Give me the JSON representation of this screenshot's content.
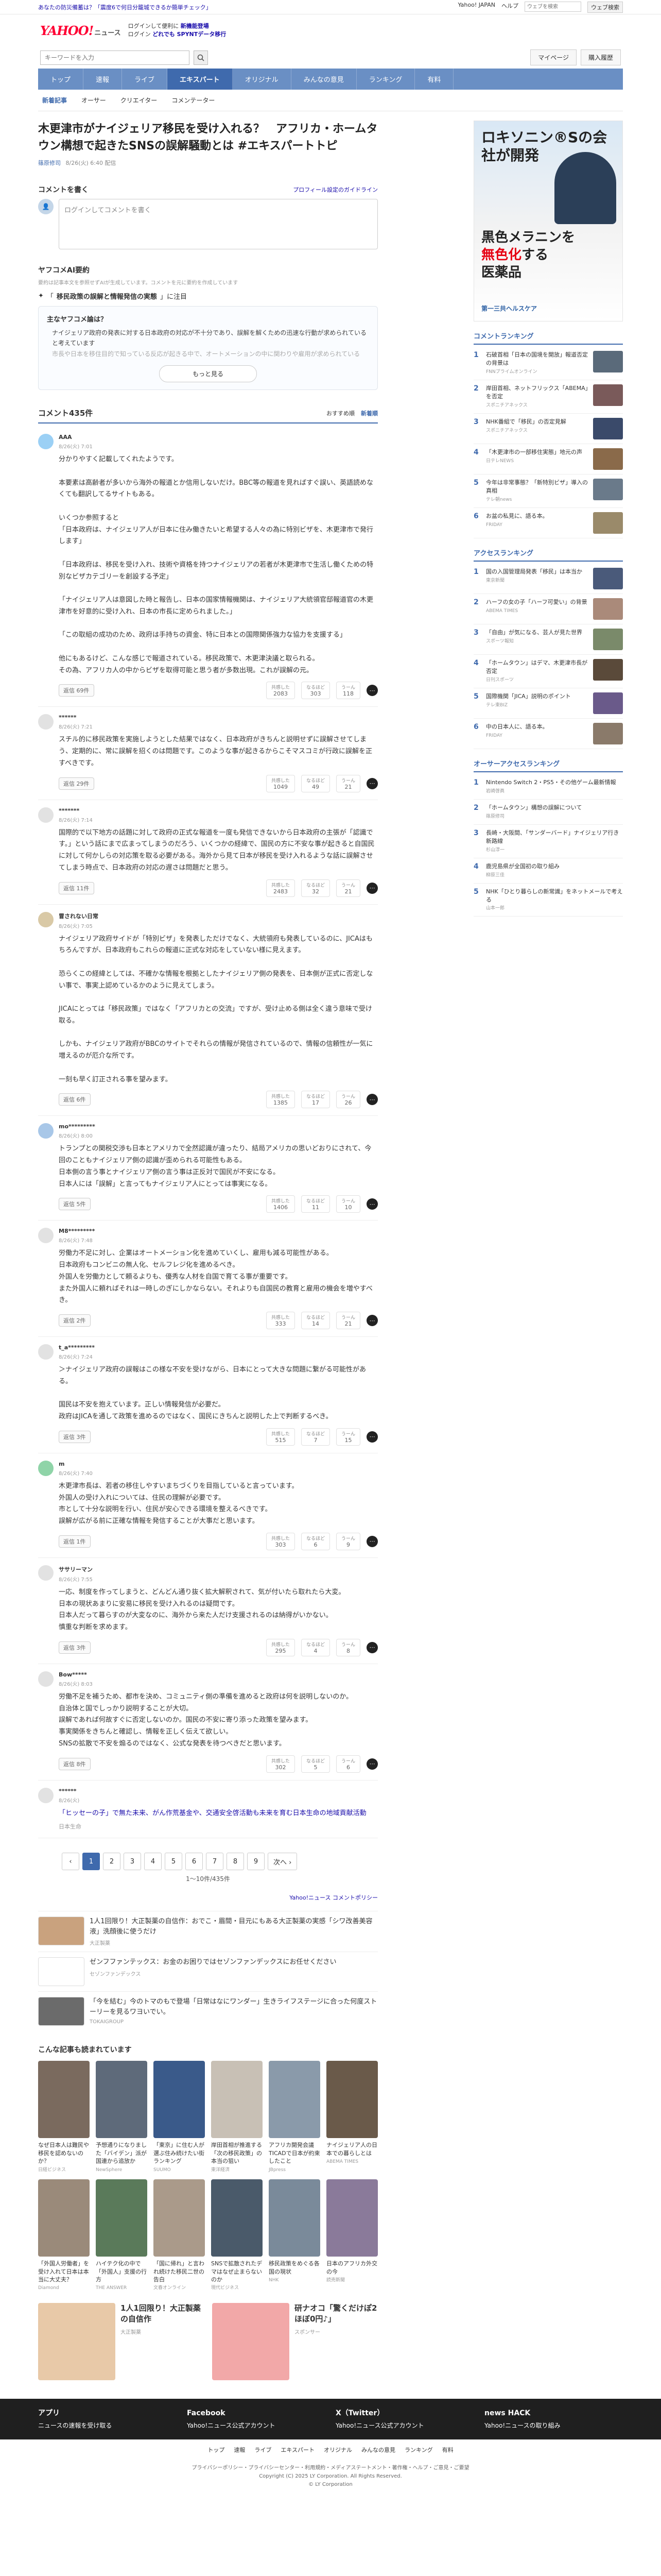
{
  "topbar": {
    "notice": "あなたの防災備蓄は？「震度6で何日分籠城できるか簡単チェック」",
    "links": [
      "Yahoo! JAPAN",
      "ヘルプ"
    ],
    "search_placeholder": "ウェブを検索",
    "search_button": "ウェブ検索"
  },
  "header": {
    "logo": "YAHOO!",
    "logo_sub": "ニュース",
    "info_line1": "ログインして便利に",
    "info_line1_b": "新機能登場",
    "info_line2": "ログイン",
    "info_line2_b": "どれでも SPYNTデータ移行",
    "search_button": "検索"
  },
  "searchbar": {
    "placeholder": "キーワードを入力",
    "right_buttons": [
      "マイページ",
      "購入履歴"
    ]
  },
  "nav": {
    "items": [
      "トップ",
      "速報",
      "ライブ",
      "エキスパート",
      "オリジナル",
      "みんなの意見",
      "ランキング",
      "有料"
    ],
    "active": "エキスパート"
  },
  "subnav": {
    "items": [
      "新着記事",
      "オーサー",
      "クリエイター",
      "コメンテーター"
    ]
  },
  "article": {
    "title": "木更津市がナイジェリア移民を受け入れる？　アフリカ・ホームタウン構想で起きたSNSの誤解騒動とは #エキスパートトピ",
    "author": "篠原修司",
    "date": "8/26(火) 6:40 配信"
  },
  "comment_form": {
    "heading": "コメントを書く",
    "policy_link": "プロフィール設定のガイドライン",
    "placeholder": "ログインしてコメントを書く"
  },
  "ai_summary": {
    "heading": "ヤフコメAI要約",
    "note": "要約は記事本文を参照せずAIが生成しています。コメントを元に要約を作成しています",
    "topic_prefix": "「",
    "topic": "移民政策の誤解と情報発信の実態",
    "topic_suffix": "」に注目",
    "card_title": "主なヤフコメ論は？",
    "points": [
      "ナイジェリア政府の発表に対する日本政府の対応が不十分であり、誤解を解くための迅速な行動が求められていると考えています",
      "市長や日本を移住目的で知っている反応が起きる中で、オートメーションの中に関わりや雇用が求められている"
    ],
    "more_button": "もっと見る"
  },
  "comments_meta": {
    "count_label": "コメント435件",
    "sort": [
      "おすすめ順",
      "新着順"
    ]
  },
  "comments": [
    {
      "name": "AAA",
      "date": "8/26(火) 7:01",
      "text": "分かりやすく記載してくれたようです。\n\n本要素は高齢者が多いから海外の報道とか信用しないだけ。BBC等の報道を見ればすぐ誤い、英語読めなくても翻訳してるサイトもある。\n\nいくつか参照すると\n「日本政府は、ナイジェリア人が日本に住み働きたいと希望する人々の為に特別ビザを、木更津市で発行します」\n\n「日本政府は、移民を受け入れ、技術や資格を持つナイジェリアの若者が木更津市で生活し働くための特別なビザカテゴリーを創設する予定」\n\n「ナイジェリア人は意図した時と報告し、日本の国家情報機関は、ナイジェリア大統領官邸報道官の木更津市を好意的に受け入れ、日本の市長に定められました。」\n\n「この取組の成功のため、政府は手持ちの資金、特に日本との国際関係強力な協力を支援する」\n\n他にもあるけど、こんな感じで報道されている。移民政策で、木更津決議と取られる。\nその為、アフリカ人の中からビザを取得可能と思う者が多数出現。これが誤解の元。",
      "reply": "返信 69件",
      "react": [
        [
          "共感した",
          "2083"
        ],
        [
          "なるほど",
          "303"
        ],
        [
          "うーん",
          "118"
        ]
      ],
      "avatar": "#9bd0f5"
    },
    {
      "name": "******",
      "date": "8/26(火) 7:21",
      "text": "スチル的に移民政策を実施しようとした結果ではなく、日本政府がきちんと説明せずに誤解させてしまう、定期的に、常に誤解を招くのは問題です。このような事が起きるからこそマスコミが行政に誤解を正すべきです。",
      "reply": "返信 29件",
      "react": [
        [
          "共感した",
          "1049"
        ],
        [
          "なるほど",
          "49"
        ],
        [
          "うーん",
          "21"
        ]
      ],
      "avatar": "#e2e2e2"
    },
    {
      "name": "*******",
      "date": "8/26(火) 7:14",
      "text": "国際的で以下地方の話題に対して政府の正式な報道を一度も発信できないから日本政府の主張が「認識です。」という話にまで広まってしまうのだろう、いくつかの経緯で、国民の方に不安な事が起きると自国民に対して何かしらの対応策を取る必要がある。海外から見て日本が移民を受け入れるような話に誤解させてしまう時点で、日本政府の対応の遅さは問題だと思う。",
      "reply": "返信 11件",
      "react": [
        [
          "共感した",
          "2483"
        ],
        [
          "なるほど",
          "32"
        ],
        [
          "うーん",
          "21"
        ]
      ],
      "avatar": "#e2e2e2"
    },
    {
      "name": "冒されない日常",
      "date": "8/26(火) 7:05",
      "text": "ナイジェリア政府サイドが「特別ビザ」を発表しただけでなく、大統領府も発表しているのに、JICAはもちろんですが、日本政府もこれらの報道に正式な対応をしていない様に見えます。\n\n恐らくこの経緯としては、不確かな情報を根拠としたナイジェリア側の発表を、日本側が正式に否定しない事で、事実上認めているかのように見えてしまう。\n\nJICAにとっては「移民政策」ではなく「アフリカとの交流」ですが、受け止める側は全く違う意味で受け取る。\n\nしかも、ナイジェリア政府がBBCのサイトでそれらの情報が発信されているので、情報の信頼性が一気に増えるのが厄介な所です。\n\n一刻も早く訂正される事を望みます。",
      "reply": "返信 6件",
      "react": [
        [
          "共感した",
          "1385"
        ],
        [
          "なるほど",
          "17"
        ],
        [
          "うーん",
          "26"
        ]
      ],
      "avatar": "#d9c9a6"
    },
    {
      "name": "mo*********",
      "date": "8/26(火) 8:00",
      "text": "トランプとの関税交渉も日本とアメリカで全然認識が違ったり、結局アメリカの思いどおりにされて、今回のこともナイジェリア側の認識が歪められる可能性もある。\n日本側の言う事とナイジェリア側の言う事は正反対で国民が不安になる。\n日本人には「誤解」と言ってもナイジェリア人にとっては事実になる。",
      "reply": "返信 5件",
      "react": [
        [
          "共感した",
          "1406"
        ],
        [
          "なるほど",
          "11"
        ],
        [
          "うーん",
          "10"
        ]
      ],
      "avatar": "#a8c7e8"
    },
    {
      "name": "M8*********",
      "date": "8/26(火) 7:48",
      "text": "労働力不足に対し、企業はオートメーション化を進めていくし、雇用も減る可能性がある。\n日本政府もコンビニの無人化、セルフレジ化を進めるべき。\n外国人を労働力として頼るよりも、優秀な人材を自国で育てる事が重要です。\nまた外国人に頼ればそれは一時しのぎにしかならない。それよりも自国民の教育と雇用の機会を増やすべき。",
      "reply": "返信 2件",
      "react": [
        [
          "共感した",
          "333"
        ],
        [
          "なるほど",
          "14"
        ],
        [
          "うーん",
          "21"
        ]
      ],
      "avatar": "#e2e2e2"
    },
    {
      "name": "t_a*********",
      "date": "8/26(火) 7:24",
      "text": "＞ナイジェリア政府の誤報はこの様な不安を受けながら、日本にとって大きな問題に繋がる可能性がある。\n\n国民は不安を抱えています。正しい情報発信が必要だ。\n政府はJICAを通して政策を進めるのではなく、国民にきちんと説明した上で判断するべき。",
      "reply": "返信 3件",
      "react": [
        [
          "共感した",
          "515"
        ],
        [
          "なるほど",
          "7"
        ],
        [
          "うーん",
          "15"
        ]
      ],
      "avatar": "#e2e2e2"
    },
    {
      "name": "m",
      "date": "8/26(火) 7:40",
      "text": "木更津市長は、若者の移住しやすいまちづくりを目指していると言っています。\n外国人の受け入れについては、住民の理解が必要です。\n市として十分な説明を行い、住民が安心できる環境を整えるべきです。\n誤解が広がる前に正確な情報を発信することが大事だと思います。",
      "reply": "返信 1件",
      "react": [
        [
          "共感した",
          "303"
        ],
        [
          "なるほど",
          "6"
        ],
        [
          "うーん",
          "9"
        ]
      ],
      "avatar": "#8fd4a8"
    },
    {
      "name": "ササリーマン",
      "date": "8/26(火) 7:55",
      "text": "一応、制度を作ってしまうと、どんどん通り抜く拡大解釈されて、気が付いたら取れたら大変。\n日本の現状あまりに安易に移民を受け入れるのは疑問です。\n日本人だって暮らすのが大変なのに、海外から来た人だけ支援されるのは納得がいかない。\n慎重な判断を求めます。",
      "reply": "返信 3件",
      "react": [
        [
          "共感した",
          "295"
        ],
        [
          "なるほど",
          "4"
        ],
        [
          "うーん",
          "8"
        ]
      ],
      "avatar": "#e2e2e2"
    },
    {
      "name": "Bow*****",
      "date": "8/26(火) 8:03",
      "text": "労働不足を補うため、都市を決め、コミュニティ側の準備を進めると政府は何を説明しないのか。\n自治体と国でしっかり説明することが大切。\n誤解であれば何故すぐに否定しないのか。国民の不安に寄り添った政策を望みます。\n事実関係をきちんと確認し、情報を正しく伝えて欲しい。\nSNSの拡散で不安を煽るのではなく、公式な発表を待つべきだと思います。",
      "reply": "返信 8件",
      "react": [
        [
          "共感した",
          "302"
        ],
        [
          "なるほど",
          "5"
        ],
        [
          "うーん",
          "6"
        ]
      ],
      "avatar": "#e2e2e2"
    }
  ],
  "ps_comment": {
    "name": "******",
    "date": "8/26(火)",
    "text": "「ヒッセーの子」で無た未来、がん作荒基金や、交通安全啓活動も未来を育む日本生命の地域貢献活動",
    "sponsor": "日本生命"
  },
  "pager": {
    "pages": [
      "1",
      "2",
      "3",
      "4",
      "5",
      "6",
      "7",
      "8",
      "9"
    ],
    "prev": "‹",
    "next": "次へ ›",
    "active": "1",
    "count": "1〜10件/435件"
  },
  "policy_link": "Yahoo!ニュース コメントポリシー",
  "ads_list": [
    {
      "title": "1人1回限り！大正製薬の自信作：おでこ・眉間・目元にもある大正製薬の実感「シワ改善美容液」洗顔後に使うだけ",
      "sponsor": "大正製薬",
      "color": "#c9a27e"
    },
    {
      "title": "ゼンフファンテックス：お金のお困りではセゾンファンデックスにお任せください",
      "sponsor": "セゾンファンデックス",
      "color": "#ffffff"
    },
    {
      "title": "「今を結む」今のトマのもで登場「日常はなにワンダー」生きライフステージに合った何度ストーリーを見るワヨいでい。",
      "sponsor": "TOKAIGROUP",
      "color": "#6b6b6b"
    }
  ],
  "rec_heading": "こんな記事も読まれています",
  "recs": [
    {
      "title": "なぜ日本人は難民や移民を認めないのか？",
      "src": "日経ビジネス",
      "color": "#7a6a5e"
    },
    {
      "title": "予想通りになりました「バイデン」派が国連から追放か",
      "src": "NewSphere",
      "color": "#5e6a7a"
    },
    {
      "title": "「東京」に住む人が選ぶ住み続けたい街ランキング",
      "src": "SUUMO",
      "color": "#3a5a8a"
    },
    {
      "title": "岸田首相が推進する「次の移民政策」の本当の狙い",
      "src": "東洋経済",
      "color": "#c8c0b5"
    },
    {
      "title": "アフリカ開発会議TICADで日本が約束したこと",
      "src": "JBpress",
      "color": "#8a9aaa"
    },
    {
      "title": "ナイジェリア人の日本での暮らしとは",
      "src": "ABEMA TIMES",
      "color": "#6a5a4a"
    },
    {
      "title": "「外国人労働者」を受け入れて日本は本当に大丈夫？",
      "src": "Diamond",
      "color": "#9a8a7a"
    },
    {
      "title": "ハイテク化の中で「外国人」支援の行方",
      "src": "THE ANSWER",
      "color": "#5a7a5a"
    },
    {
      "title": "「国に帰れ」と言われ続けた移民二世の告白",
      "src": "文春オンライン",
      "color": "#aa9a8a"
    },
    {
      "title": "SNSで拡散されたデマはなぜ止まらないのか",
      "src": "現代ビジネス",
      "color": "#4a5a6a"
    },
    {
      "title": "移民政策をめぐる各国の現状",
      "src": "NHK",
      "color": "#7a8a9a"
    },
    {
      "title": "日本のアフリカ外交の今",
      "src": "読売新聞",
      "color": "#8a7a9a"
    }
  ],
  "rec_ads": [
    {
      "title": "1人1回限り！大正製薬の自信作",
      "src": "大正製薬",
      "color": "#e8c9a8"
    },
    {
      "title": "研ナオコ「驚くだけぽ2ほぼ0円♪」",
      "src": "スポンサー",
      "color": "#f2a8a8"
    }
  ],
  "sidebar": {
    "ad": {
      "headline": "ロキソニン®Sの会社が開発",
      "mid_line1": "黒色メラニンを",
      "mid_line2_b": "無色化",
      "mid_line2": "する",
      "mid_line3": "医薬品",
      "brand": "第一三共ヘルスケア"
    },
    "comment_ranking_title": "コメントランキング",
    "comment_ranking": [
      {
        "title": "石破首相「日本の国境を開放」報道否定の背景は",
        "src": "FNNプライムオンライン",
        "color": "#5a6a7a"
      },
      {
        "title": "岸田首相、ネットフリックス「ABEMA」を否定",
        "src": "スポニチアネックス",
        "color": "#7a5a5a"
      },
      {
        "title": "NHK番組で「移民」の否定見解",
        "src": "スポニチアネックス",
        "color": "#3a4a6a"
      },
      {
        "title": "「木更津市の一部移住実態」地元の声",
        "src": "日テレNEWS",
        "color": "#8a6a4a"
      },
      {
        "title": "今年は非常事態？「新特別ビザ」導入の真相",
        "src": "テレ朝news",
        "color": "#6a7a8a"
      },
      {
        "title": "お盆の私見に、語る本。",
        "src": "FRIDAY",
        "color": "#9a8a6a"
      }
    ],
    "access_ranking_title": "アクセスランキング",
    "access_ranking": [
      {
        "title": "国の入国管理局発表「移民」は本当か",
        "src": "東京新聞",
        "color": "#4a5a7a"
      },
      {
        "title": "ハーフの女の子「ハーフ可愛い」の背景",
        "src": "ABEMA TIMES",
        "color": "#aa8a7a"
      },
      {
        "title": "「自由」が気になる、芸人が見た世界",
        "src": "スポーツ報知",
        "color": "#7a8a6a"
      },
      {
        "title": "「ホームタウン」はデマ、木更津市長が否定",
        "src": "日刊スポーツ",
        "color": "#5a4a3a"
      },
      {
        "title": "国際機関「JICA」説明のポイント",
        "src": "テレ東BIZ",
        "color": "#6a5a8a"
      },
      {
        "title": "中の日本人に、語る本。",
        "src": "FRIDAY",
        "color": "#8a7a6a"
      }
    ],
    "author_ranking_title": "オーサーアクセスランキング",
    "author_ranking": [
      {
        "title": "Nintendo Switch 2・PS5・その他ゲーム最新情報",
        "src": "岩崎啓眞"
      },
      {
        "title": "「ホームタウン」構想の誤解について",
        "src": "篠原修司"
      },
      {
        "title": "長崎・大阪間、「サンダーバード」ナイジェリア行き新路線",
        "src": "杉山淳一"
      },
      {
        "title": "鹿児島県が全国初の取り組み",
        "src": "柳原三佳"
      },
      {
        "title": "NHK「ひとり暮らしの新常識」をネットメールで考える",
        "src": "山本一郎"
      }
    ]
  },
  "footer": {
    "cols": [
      {
        "t": "アプリ",
        "d": "ニュースの速報を受け取る"
      },
      {
        "t": "Facebook",
        "d": "Yahoo!ニュース公式アカウント"
      },
      {
        "t": "X（Twitter）",
        "d": "Yahoo!ニュース公式アカウント"
      },
      {
        "t": "news HACK",
        "d": "Yahoo!ニュースの取り組み"
      }
    ],
    "links": [
      "トップ",
      "速報",
      "ライブ",
      "エキスパート",
      "オリジナル",
      "みんなの意見",
      "ランキング",
      "有料"
    ],
    "bottom_links": "プライバシーポリシー・プライバシーセンター・利用規約・メディアステートメント・著作権・ヘルプ・ご意見・ご要望",
    "copyright": "Copyright (C) 2025 LY Corporation. All Rights Reserved.",
    "corp": "© LY Corporation"
  },
  "colors": {
    "accent": "#3f6aad",
    "brand_red": "#ff0033"
  }
}
